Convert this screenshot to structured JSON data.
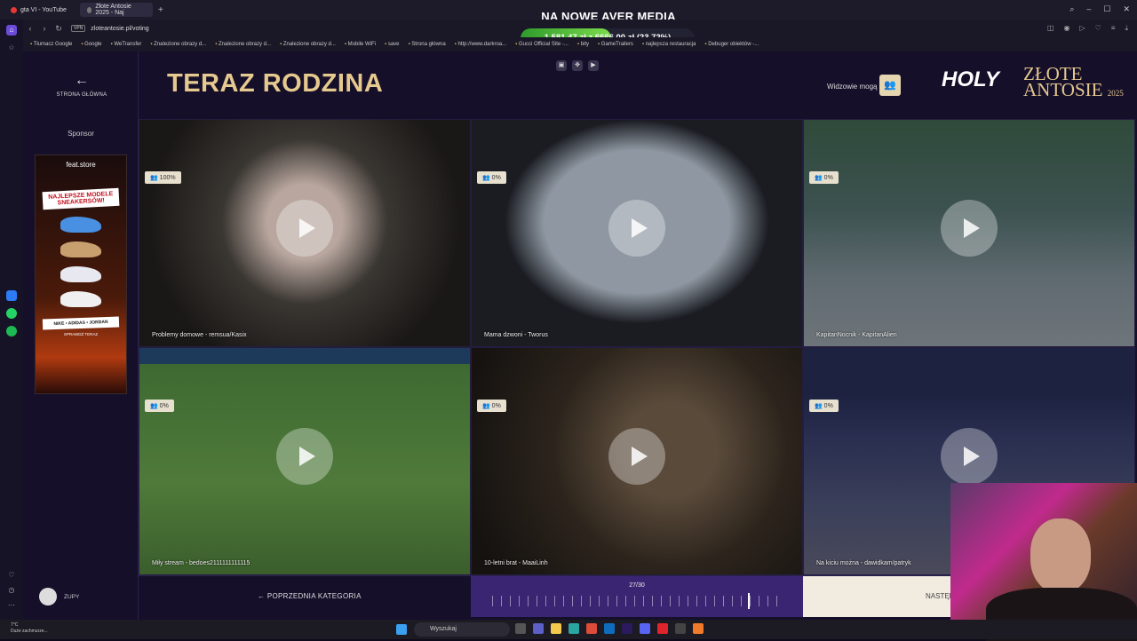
{
  "browser": {
    "tabs": [
      {
        "title": "gta VI - YouTube",
        "color": "#e53935"
      },
      {
        "title": "Złote Antosie 2025 - Naj",
        "color": "#777777"
      }
    ],
    "url": "zloteantosie.pl/voting",
    "vpn": "VPN",
    "bookmarks": [
      "Tłumacz Google",
      "Google",
      "WeTransfer",
      "Znalezione obrazy d...",
      "Znalezione obrazy d...",
      "Znalezione obrazy d...",
      "Mobile WiFi",
      "save",
      "Strona główna",
      "http://www.darkroa...",
      "Gucci Official Site -...",
      "bity",
      "GameTrailers",
      "najlepsza restauracja",
      "Debuger obiektów -..."
    ]
  },
  "overlay": {
    "banner": "NA NOWE AVER MEDIA",
    "goal_text": "1 581,47 zł z 6666,00 zł (23.72%)",
    "goal_percent": 23.72
  },
  "page": {
    "home_label": "STRONA GŁÓWNA",
    "title": "TERAZ RODZINA",
    "viewers_label": "Widzowie mogą",
    "logo_holy": "HOLY",
    "logo_main": "ZŁOTE ANTOSIE",
    "logo_year": "2025",
    "sponsor_label": "Sponsor",
    "ad": {
      "brand": "feat.store",
      "headline": "NAJLEPSZE MODELE SNEAKERSÓW!",
      "brands": "NIKE • ADIDAS • JORDAN",
      "cta": "SPRAWDŹ TERAZ"
    },
    "user_label": "ZUPY"
  },
  "clips": [
    {
      "title": "Problemy domowe - remsua/Kasix",
      "votes": "100%"
    },
    {
      "title": "Mama dzwoni - Tworus",
      "votes": "0%"
    },
    {
      "title": "KapitanNocnik - KapitanAlien",
      "votes": "0%"
    },
    {
      "title": "Miły stream - bedoes2111111111115",
      "votes": "0%"
    },
    {
      "title": "10-letni brat - MaaiLinh",
      "votes": "0%"
    },
    {
      "title": "Na kiciu można - dawidkam/patryk",
      "votes": "0%"
    }
  ],
  "footer": {
    "prev_label": "POPRZEDNIA KATEGORIA",
    "progress_label": "27/30",
    "progress_current": 27,
    "progress_total": 30,
    "next_label": "NASTĘP"
  },
  "taskbar": {
    "weather": "7°C",
    "weather_sub": "Duże zachmurze...",
    "search": "Wyszukaj"
  }
}
